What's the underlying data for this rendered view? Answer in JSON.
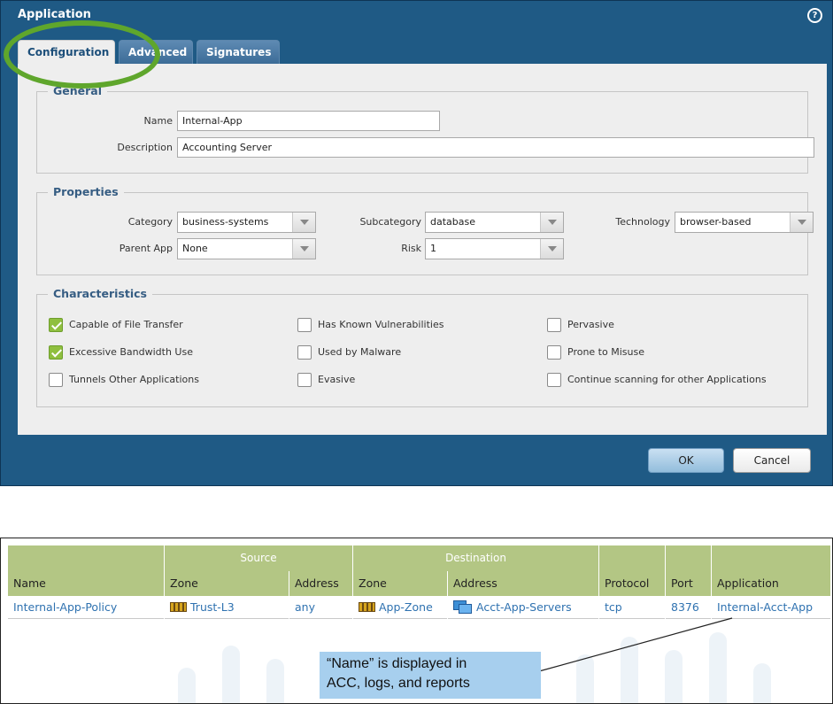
{
  "dialog": {
    "title": "Application",
    "help_icon": "?",
    "tabs": [
      {
        "label": "Configuration",
        "active": true
      },
      {
        "label": "Advanced",
        "active": false
      },
      {
        "label": "Signatures",
        "active": false
      }
    ],
    "general": {
      "legend": "General",
      "name_label": "Name",
      "name_value": "Internal-App",
      "description_label": "Description",
      "description_value": "Accounting Server"
    },
    "properties": {
      "legend": "Properties",
      "category_label": "Category",
      "category_value": "business-systems",
      "subcategory_label": "Subcategory",
      "subcategory_value": "database",
      "technology_label": "Technology",
      "technology_value": "browser-based",
      "parent_app_label": "Parent App",
      "parent_app_value": "None",
      "risk_label": "Risk",
      "risk_value": "1"
    },
    "characteristics": {
      "legend": "Characteristics",
      "items": [
        {
          "label": "Capable of File Transfer",
          "checked": true
        },
        {
          "label": "Has Known Vulnerabilities",
          "checked": false
        },
        {
          "label": "Pervasive",
          "checked": false
        },
        {
          "label": "Excessive Bandwidth Use",
          "checked": true
        },
        {
          "label": "Used by Malware",
          "checked": false
        },
        {
          "label": "Prone to Misuse",
          "checked": false
        },
        {
          "label": "Tunnels Other Applications",
          "checked": false
        },
        {
          "label": "Evasive",
          "checked": false
        },
        {
          "label": "Continue scanning for other Applications",
          "checked": false
        }
      ]
    },
    "buttons": {
      "ok": "OK",
      "cancel": "Cancel"
    }
  },
  "policy_table": {
    "group_headers": {
      "source": "Source",
      "destination": "Destination"
    },
    "columns": [
      "Name",
      "Zone",
      "Address",
      "Zone",
      "Address",
      "Protocol",
      "Port",
      "Application"
    ],
    "row": {
      "name": "Internal-App-Policy",
      "source_zone": "Trust-L3",
      "source_address": "any",
      "dest_zone": "App-Zone",
      "dest_address": "Acct-App-Servers",
      "protocol": "tcp",
      "port": "8376",
      "application": "Internal-Acct-App"
    }
  },
  "callout": {
    "line1": "“Name” is displayed in",
    "line2": "ACC, logs, and reports"
  },
  "colors": {
    "dialog_frame": "#1f5a85",
    "panel_bg": "#eeeeee",
    "legend_text": "#365d83",
    "highlight_ring": "#5fa62c",
    "checkbox_checked": "#8fbf3f",
    "table_header": "#b3c684",
    "table_link": "#2f72b0",
    "callout_bg": "#a7cfee"
  }
}
